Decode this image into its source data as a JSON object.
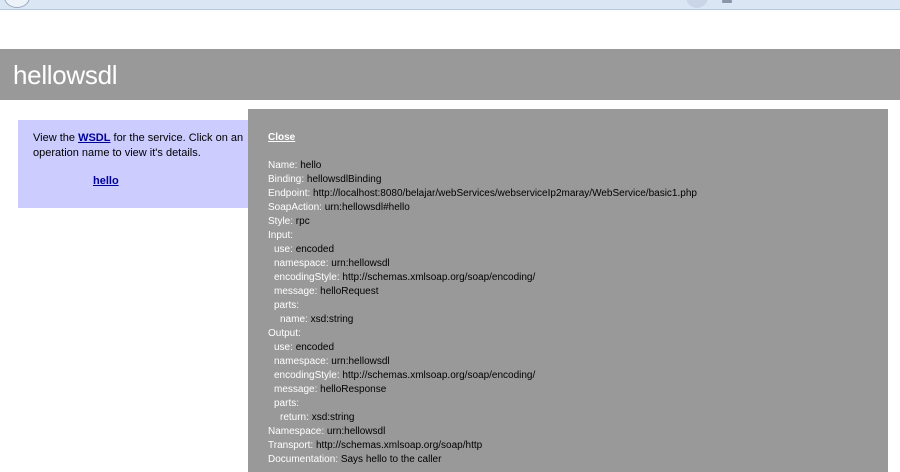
{
  "page": {
    "title": "hellowsdl"
  },
  "sidebar": {
    "intro_prefix": "View the ",
    "wsdl_link": "WSDL",
    "intro_suffix": " for the service. Click on an operation name to view it's details.",
    "operation": "hello"
  },
  "popup": {
    "close": "Close",
    "rows": [
      {
        "label": "Name:",
        "value": "hello",
        "indent": 0
      },
      {
        "label": "Binding:",
        "value": "hellowsdlBinding",
        "indent": 0
      },
      {
        "label": "Endpoint:",
        "value": "http://localhost:8080/belajar/webServices/webserviceIp2maray/WebService/basic1.php",
        "indent": 0
      },
      {
        "label": "SoapAction:",
        "value": "urn:hellowsdl#hello",
        "indent": 0
      },
      {
        "label": "Style:",
        "value": "rpc",
        "indent": 0
      },
      {
        "label": "Input:",
        "value": "",
        "indent": 0
      },
      {
        "label": "use:",
        "value": "encoded",
        "indent": 1
      },
      {
        "label": "namespace:",
        "value": "urn:hellowsdl",
        "indent": 1
      },
      {
        "label": "encodingStyle:",
        "value": "http://schemas.xmlsoap.org/soap/encoding/",
        "indent": 1
      },
      {
        "label": "message:",
        "value": "helloRequest",
        "indent": 1
      },
      {
        "label": "parts:",
        "value": "",
        "indent": 1
      },
      {
        "label": "name:",
        "value": "xsd:string",
        "indent": 2
      },
      {
        "label": "Output:",
        "value": "",
        "indent": 0
      },
      {
        "label": "use:",
        "value": "encoded",
        "indent": 1
      },
      {
        "label": "namespace:",
        "value": "urn:hellowsdl",
        "indent": 1
      },
      {
        "label": "encodingStyle:",
        "value": "http://schemas.xmlsoap.org/soap/encoding/",
        "indent": 1
      },
      {
        "label": "message:",
        "value": "helloResponse",
        "indent": 1
      },
      {
        "label": "parts:",
        "value": "",
        "indent": 1
      },
      {
        "label": "return:",
        "value": "xsd:string",
        "indent": 2
      },
      {
        "label": "Namespace:",
        "value": "urn:hellowsdl",
        "indent": 0
      },
      {
        "label": "Transport:",
        "value": "http://schemas.xmlsoap.org/soap/http",
        "indent": 0
      },
      {
        "label": "Documentation:",
        "value": "Says hello to the caller",
        "indent": 0
      }
    ]
  },
  "colors": {
    "header": "#999999",
    "panel": "#ccccff",
    "popup": "#999999",
    "label": "#ffffff",
    "link": "#000099"
  }
}
